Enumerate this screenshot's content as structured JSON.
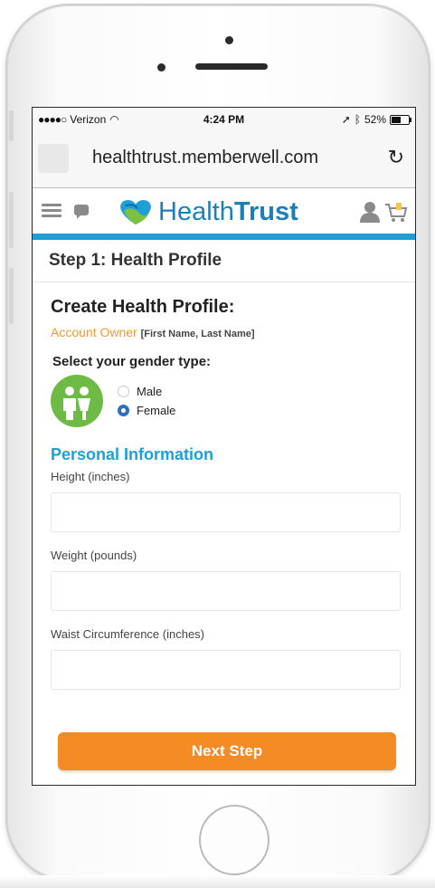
{
  "status_bar": {
    "carrier": "Verizon",
    "time": "4:24 PM",
    "battery": "52%"
  },
  "browser": {
    "url": "healthtrust.memberwell.com",
    "reload_icon": "reload-icon"
  },
  "site_header": {
    "brand_light": "Health",
    "brand_bold": "Trust",
    "accent_color": "#1ea0d6"
  },
  "step": {
    "title": "Step 1: Health Profile"
  },
  "profile": {
    "heading": "Create Health Profile:",
    "owner_label": "Account Owner",
    "owner_hint": "[First Name, Last Name]"
  },
  "gender": {
    "title": "Select your gender type:",
    "options": [
      {
        "label": "Male",
        "checked": false
      },
      {
        "label": "Female",
        "checked": true
      }
    ]
  },
  "personal": {
    "title": "Personal Information",
    "fields": [
      {
        "label": "Height (inches)",
        "value": ""
      },
      {
        "label": "Weight (pounds)",
        "value": ""
      },
      {
        "label": "Waist Circumference (inches)",
        "value": ""
      }
    ]
  },
  "actions": {
    "next_label": "Next Step",
    "button_color": "#f58b25"
  }
}
